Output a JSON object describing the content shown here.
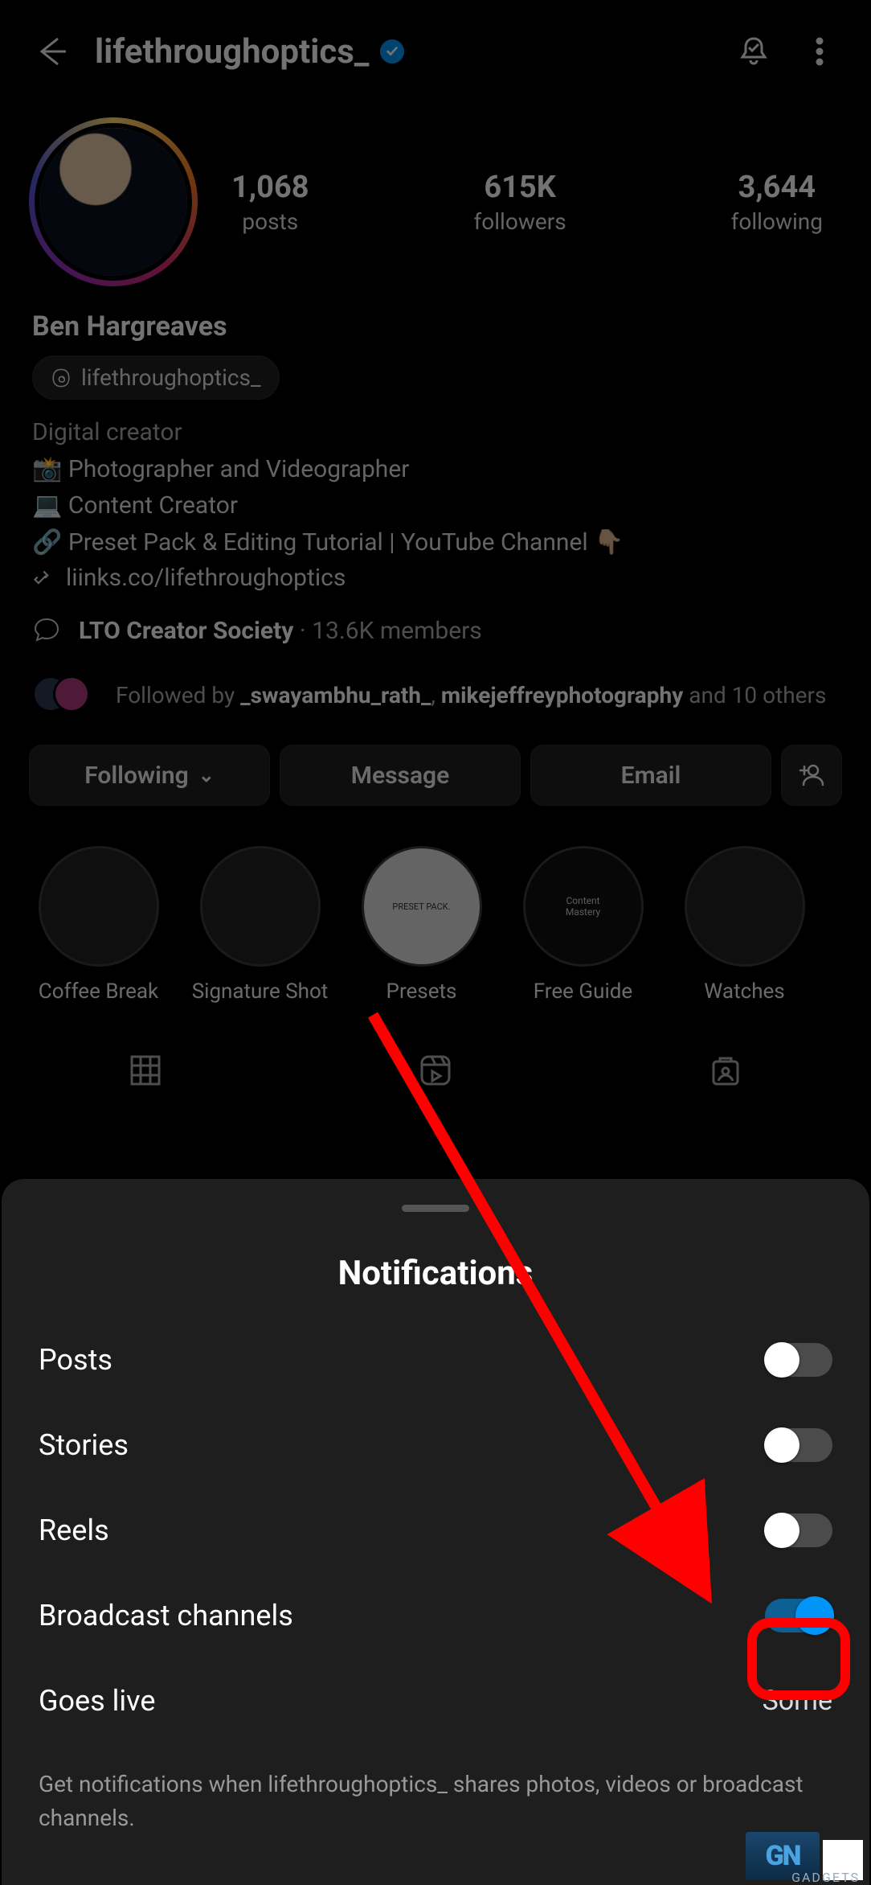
{
  "header": {
    "username": "lifethroughoptics_",
    "verified": true
  },
  "stats": {
    "posts": {
      "value": "1,068",
      "label": "posts"
    },
    "followers": {
      "value": "615K",
      "label": "followers"
    },
    "following": {
      "value": "3,644",
      "label": "following"
    }
  },
  "bio": {
    "display_name": "Ben Hargreaves",
    "threads_handle": "lifethroughoptics_",
    "category": "Digital creator",
    "line1_icon": "📸",
    "line1": "Photographer and Videographer",
    "line2_icon": "💻",
    "line2": "Content Creator",
    "line3_icon": "🔗",
    "line3": "Preset Pack & Editing Tutorial | YouTube Channel",
    "line3_trail": "👇🏼",
    "link_text": "liinks.co/lifethroughoptics"
  },
  "channel": {
    "name": "LTO Creator Society",
    "members": "13.6K members"
  },
  "followed_by": {
    "lead": "Followed by ",
    "handle1": "_swayambhu_rath_",
    "sep": ", ",
    "handle2": "mikejeffreyphotography",
    "trail": " and 10 others"
  },
  "actions": {
    "following": "Following",
    "message": "Message",
    "email": "Email"
  },
  "highlights": [
    {
      "label": "Coffee Break"
    },
    {
      "label": "Signature Shot"
    },
    {
      "label": "Presets"
    },
    {
      "label": "Free Guide"
    },
    {
      "label": "Watches"
    }
  ],
  "sheet": {
    "title": "Notifications",
    "options": {
      "posts": "Posts",
      "stories": "Stories",
      "reels": "Reels",
      "broadcast": "Broadcast channels",
      "goes_live": "Goes live",
      "goes_live_value": "Some"
    },
    "hint": "Get notifications when lifethroughoptics_ shares photos, videos or broadcast channels."
  },
  "watermark": {
    "brand": "GADGETS"
  }
}
